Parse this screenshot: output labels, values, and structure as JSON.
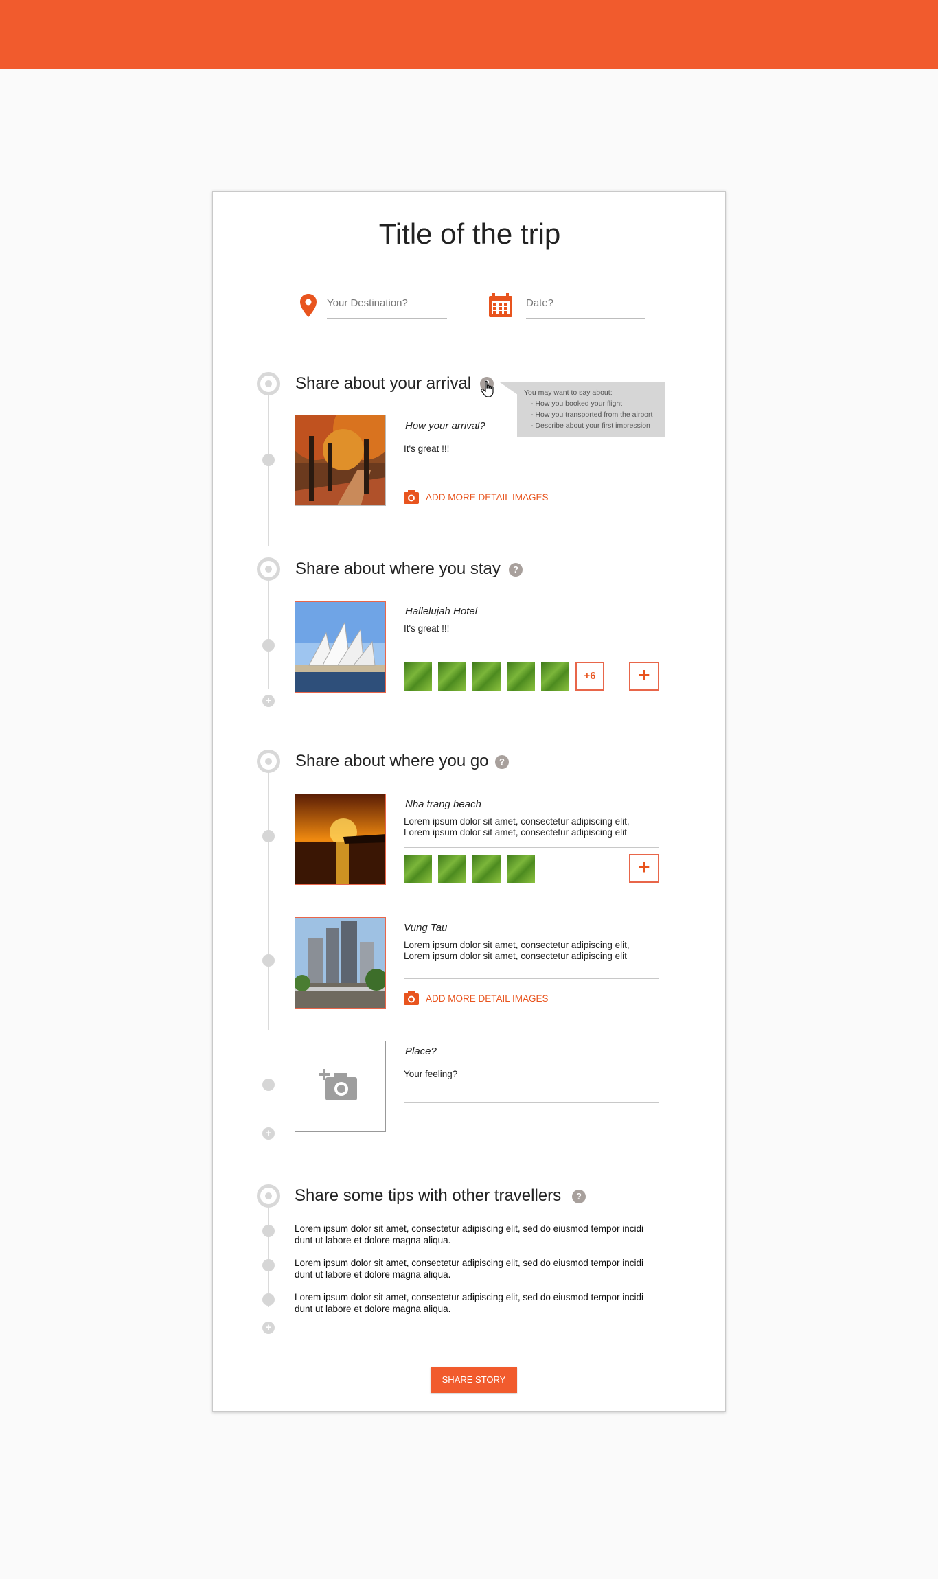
{
  "header": {},
  "trip": {
    "title": "Title of the trip",
    "destination_placeholder": "Your Destination?",
    "date_placeholder": "Date?"
  },
  "sections": {
    "arrival": {
      "title": "Share about your arrival",
      "help": "?",
      "tooltip": {
        "heading": "You may want to say about:",
        "items": [
          "- How you booked your flight",
          "- How you transported from the airport",
          "- Describe about your first impression"
        ]
      },
      "entry": {
        "title": "How your arrival?",
        "text": "It's great !!!"
      },
      "add_images": "ADD MORE DETAIL IMAGES"
    },
    "stay": {
      "title": "Share about where you stay",
      "help": "?",
      "entry": {
        "title": "Hallelujah Hotel",
        "text": "It's great !!!"
      },
      "more_count": "+6",
      "add": "+"
    },
    "go": {
      "title": "Share about where you go",
      "help": "?",
      "entries": [
        {
          "title": "Nha trang beach",
          "line1": "Lorem ipsum dolor sit amet, consectetur adipiscing elit,",
          "line2": "Lorem ipsum dolor sit amet, consectetur adipiscing elit"
        },
        {
          "title": "Vung Tau",
          "line1": "Lorem ipsum dolor sit amet, consectetur adipiscing elit,",
          "line2": "Lorem ipsum dolor sit amet, consectetur adipiscing elit"
        },
        {
          "title": "Place?",
          "line1": "Your feeling?"
        }
      ],
      "add": "+",
      "add_images": "ADD MORE DETAIL IMAGES"
    },
    "tips": {
      "title": "Share some tips with other travellers",
      "help": "?",
      "items": [
        {
          "line1": "Lorem ipsum dolor sit amet, consectetur adipiscing elit, sed do eiusmod tempor incidi",
          "line2": "dunt ut labore et dolore magna aliqua."
        },
        {
          "line1": "Lorem ipsum dolor sit amet, consectetur adipiscing elit, sed do eiusmod tempor incidi",
          "line2": "dunt ut labore et dolore magna aliqua."
        },
        {
          "line1": "Lorem ipsum dolor sit amet, consectetur adipiscing elit, sed do eiusmod tempor incidi",
          "line2": "dunt ut labore et dolore magna aliqua."
        }
      ]
    }
  },
  "share_button": "SHARE STORY",
  "colors": {
    "accent": "#f15b2d",
    "timeline": "#d8d8d8",
    "help": "#a8a09c"
  }
}
